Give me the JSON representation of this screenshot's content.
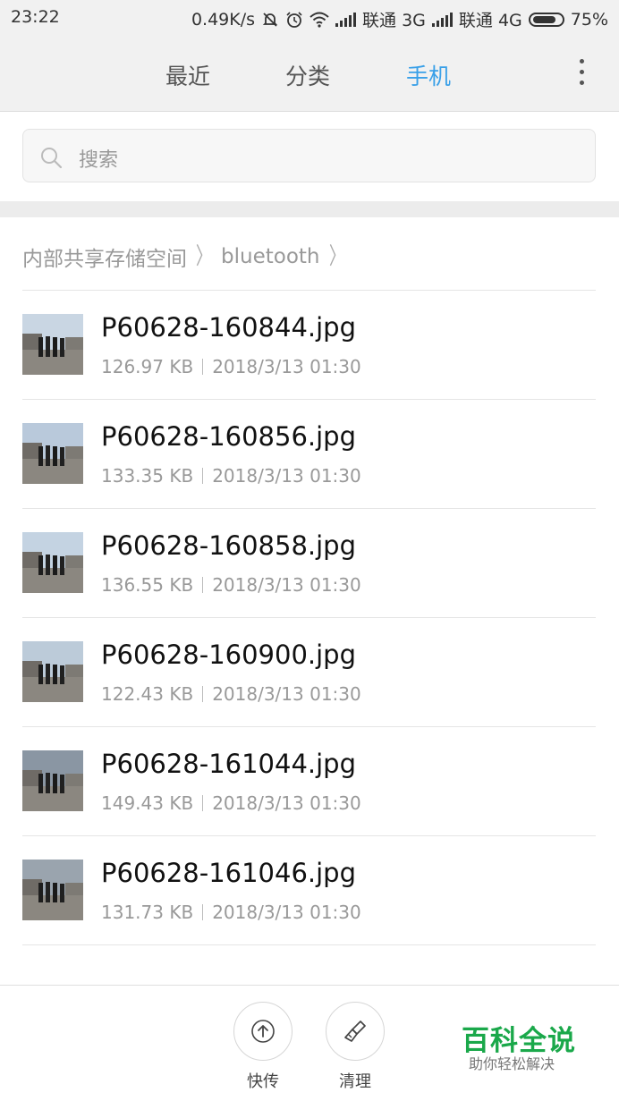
{
  "status_bar": {
    "time": "23:22",
    "speed": "0.49K/s",
    "carrier1": "联通 3G",
    "carrier2": "联通 4G",
    "battery": "75%"
  },
  "tabs": [
    {
      "label": "最近",
      "active": false
    },
    {
      "label": "分类",
      "active": false
    },
    {
      "label": "手机",
      "active": true
    }
  ],
  "search": {
    "placeholder": "搜索"
  },
  "breadcrumb": [
    "内部共享存储空间",
    "bluetooth"
  ],
  "files": [
    {
      "name": "P60628-160844.jpg",
      "size": "126.97 KB",
      "date": "2018/3/13 01:30"
    },
    {
      "name": "P60628-160856.jpg",
      "size": "133.35 KB",
      "date": "2018/3/13 01:30"
    },
    {
      "name": "P60628-160858.jpg",
      "size": "136.55 KB",
      "date": "2018/3/13 01:30"
    },
    {
      "name": "P60628-160900.jpg",
      "size": "122.43 KB",
      "date": "2018/3/13 01:30"
    },
    {
      "name": "P60628-161044.jpg",
      "size": "149.43 KB",
      "date": "2018/3/13 01:30"
    },
    {
      "name": "P60628-161046.jpg",
      "size": "131.73 KB",
      "date": "2018/3/13 01:30"
    }
  ],
  "bottom": {
    "share_label": "快传",
    "clean_label": "清理"
  },
  "watermark": {
    "title": "百科全说",
    "subtitle": "助你轻松解决"
  },
  "colors": {
    "accent": "#3aa0e8",
    "watermark": "#1aa84a"
  }
}
